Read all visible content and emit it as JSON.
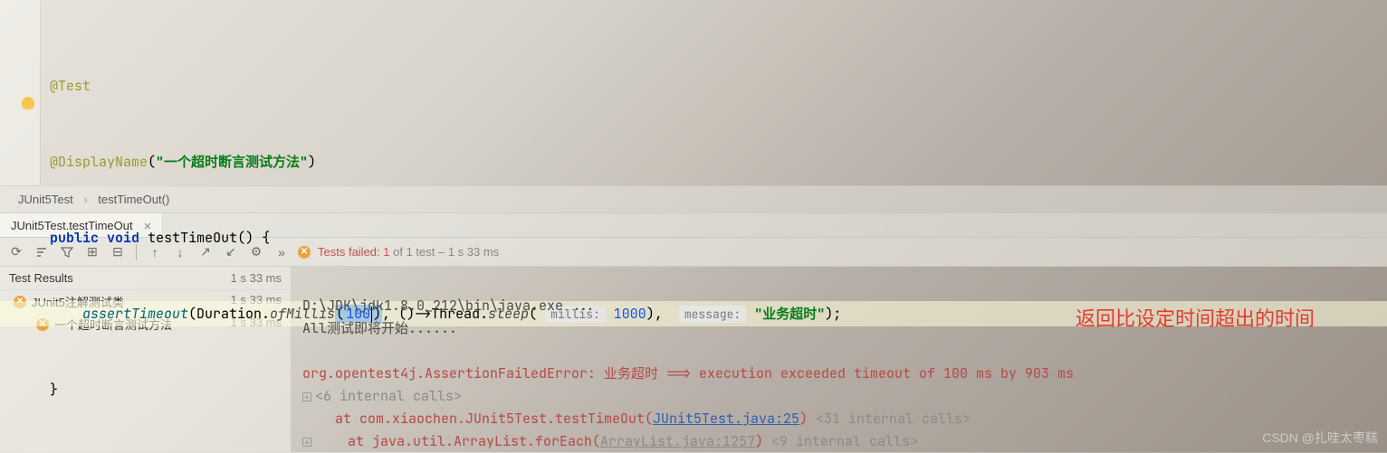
{
  "code": {
    "annotation_test": "@Test",
    "annotation_dn": "@DisplayName",
    "dn_value": "\"一个超时断言测试方法\"",
    "kw_public": "public",
    "kw_void": "void",
    "method_name": "testTimeOut",
    "assert_call": "assertTimeout",
    "duration_class": "Duration",
    "of_millis": "ofMillis",
    "millis_val": "100",
    "lambda": "()->Thread.",
    "sleep": "sleep",
    "hint_millis": "millis:",
    "sleep_val": "1000",
    "hint_message": "message:",
    "msg_val": "\"业务超时\""
  },
  "breadcrumb": {
    "class": "JUnit5Test",
    "method": "testTimeOut()"
  },
  "run_tab": "JUnit5Test.testTimeOut",
  "status": {
    "prefix": "Tests failed: ",
    "fail_count": "1",
    "of_text": " of 1 test",
    "time": " – 1 s 33 ms"
  },
  "tree": {
    "header": "Test Results",
    "header_time": "1 s 33 ms",
    "l1": "JUnit5注解测试类",
    "l1_time": "1 s 33 ms",
    "l2": "一个超时断言测试方法",
    "l2_time": "1 s 33 ms"
  },
  "console": {
    "line1": "D:\\JDK\\jdk1.8.0_212\\bin\\java.exe ...",
    "line2": "All测试即将开始......",
    "error": "org.opentest4j.AssertionFailedError: 业务超时 ==> execution exceeded timeout of 100 ms by 903 ms",
    "internal1": "<6 internal calls>",
    "at1_pre": "    at com.xiaochen.JUnit5Test.testTimeOut(",
    "at1_link": "JUnit5Test.java:25",
    "at1_post": ") ",
    "at1_internal": "<31 internal calls>",
    "at2_pre": "    at java.util.ArrayList.forEach(",
    "at2_link": "ArrayList.java:1257",
    "at2_post": ") ",
    "at2_internal": "<9 internal calls>"
  },
  "red_note": "返回比设定时间超出的时间",
  "watermark": "CSDN @扎哇太枣糕"
}
